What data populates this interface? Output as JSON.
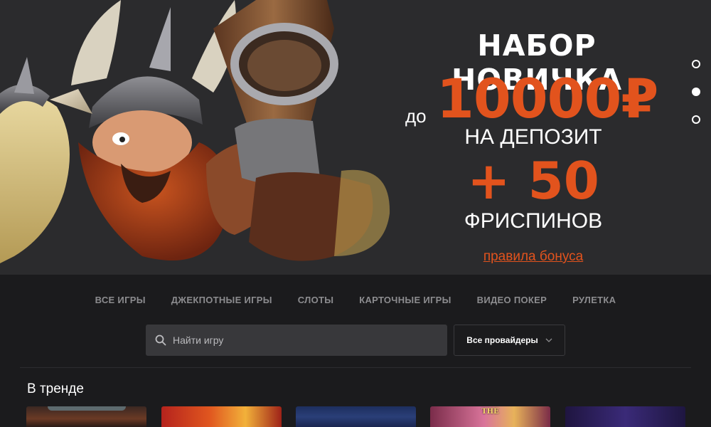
{
  "promo": {
    "title": "НАБОР НОВИЧКА",
    "prefix": "до",
    "amount": "10000₽",
    "deposit": "НА ДЕПОЗИТ",
    "plus": "+ 50",
    "spins": "ФРИСПИНОВ",
    "link": "правила бонуса"
  },
  "slider": {
    "count": 3,
    "active_index": 1
  },
  "categories": [
    "ВСЕ ИГРЫ",
    "ДЖЕКПОТНЫЕ ИГРЫ",
    "СЛОТЫ",
    "КАРТОЧНЫЕ ИГРЫ",
    "ВИДЕО ПОКЕР",
    "РУЛЕТКА"
  ],
  "search": {
    "placeholder": "Найти игру",
    "icon": "search-icon"
  },
  "providers": {
    "selected": "Все провайдеры",
    "icon": "chevron-down-icon"
  },
  "trending": {
    "title": "В тренде",
    "thumb_labels": [
      "",
      "",
      "",
      "THE",
      ""
    ]
  },
  "colors": {
    "accent": "#e2531d",
    "background": "#1b1b1d",
    "banner": "#2b2b2d",
    "nav_text": "#8c8c8f",
    "search_bg": "#38383b"
  }
}
